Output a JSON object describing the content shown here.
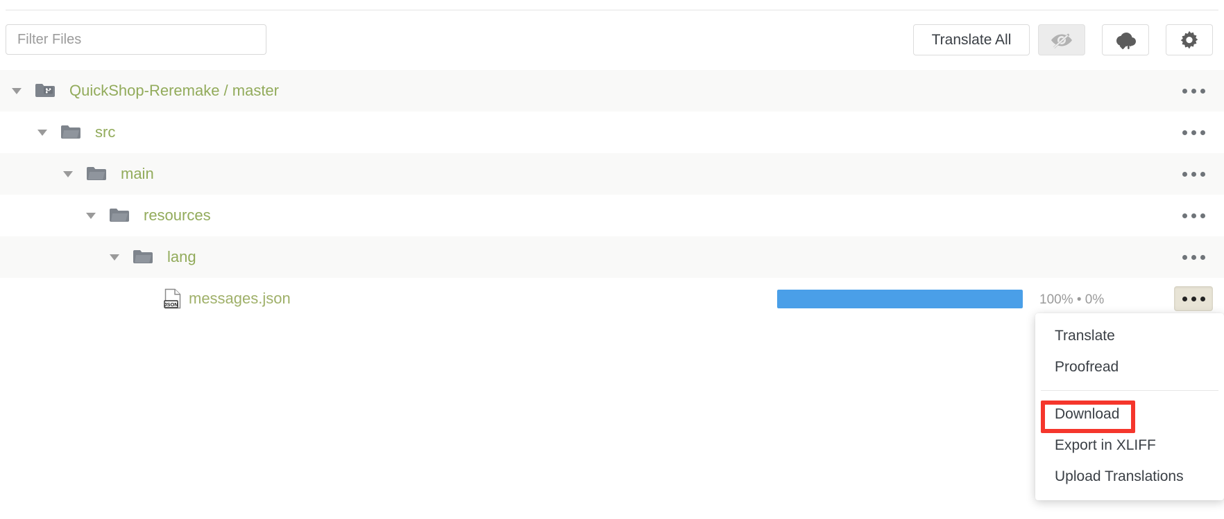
{
  "toolbar": {
    "filter": {
      "value": "",
      "placeholder": "Filter Files"
    },
    "translate_all_label": "Translate All",
    "hide_button": {
      "icon": "eye-slash-icon",
      "active": true
    },
    "sync_button": {
      "icon": "cloud-sync-icon"
    },
    "settings_button": {
      "icon": "gear-icon"
    }
  },
  "tree": {
    "rows": [
      {
        "label": "QuickShop-Reremake / master",
        "icon": "folder-branch-icon",
        "depth": 0,
        "expanded": true,
        "type": "repo",
        "menu_label": "row-actions"
      },
      {
        "label": "src",
        "icon": "folder-icon",
        "depth": 1,
        "expanded": true,
        "type": "folder",
        "menu_label": "row-actions"
      },
      {
        "label": "main",
        "icon": "folder-icon",
        "depth": 2,
        "expanded": true,
        "type": "folder",
        "menu_label": "row-actions"
      },
      {
        "label": "resources",
        "icon": "folder-icon",
        "depth": 3,
        "expanded": true,
        "type": "folder",
        "menu_label": "row-actions"
      },
      {
        "label": "lang",
        "icon": "folder-icon",
        "depth": 4,
        "expanded": true,
        "type": "folder",
        "menu_label": "row-actions"
      },
      {
        "label": "messages.json",
        "icon": "json-file-icon",
        "depth": 5,
        "expanded": false,
        "type": "file",
        "progress": {
          "translated_percent": 100,
          "approved_percent": 0,
          "fill_percent": 100,
          "text": "100% • 0%"
        },
        "menu_label": "row-actions",
        "menu_open": true
      }
    ]
  },
  "context_menu": {
    "items": [
      {
        "label": "Translate",
        "name": "menu-item-translate",
        "highlighted": false
      },
      {
        "label": "Proofread",
        "name": "menu-item-proofread",
        "highlighted": false
      },
      {
        "label": "Download",
        "name": "menu-item-download",
        "highlighted": true
      },
      {
        "label": "Export in XLIFF",
        "name": "menu-item-export-xliff",
        "highlighted": false
      },
      {
        "label": "Upload Translations",
        "name": "menu-item-upload-translations",
        "highlighted": false
      }
    ]
  },
  "colors": {
    "accent_green": "#92ab5b",
    "progress_blue": "#4a9fe8",
    "highlight_red": "#f5362c",
    "row_alt": "#f9f9f8",
    "folder_gray": "#7e848c"
  }
}
